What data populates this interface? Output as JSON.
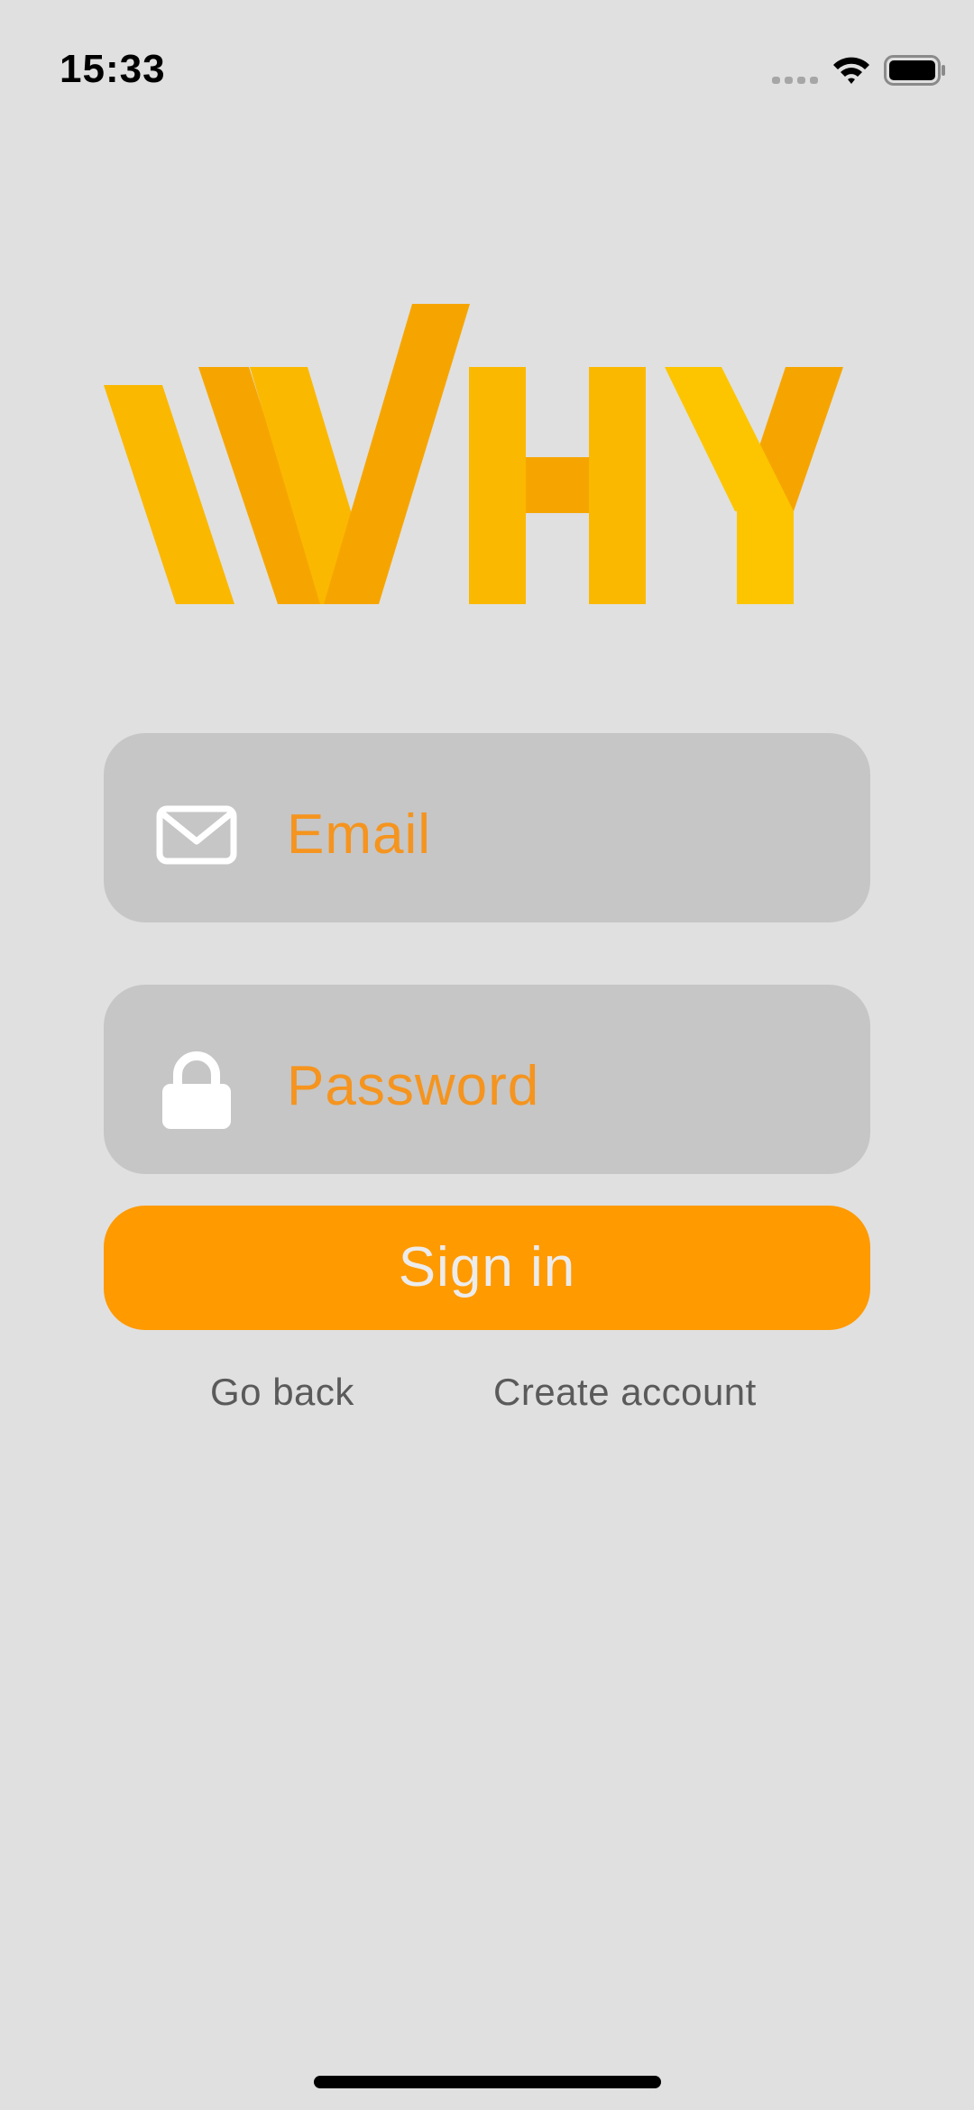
{
  "status_bar": {
    "time": "15:33",
    "signal_icon": "cellular-signal-dots-icon",
    "wifi_icon": "wifi-icon",
    "battery_icon": "battery-full-icon"
  },
  "logo": {
    "text": "WHY",
    "colors": [
      "#fbb800",
      "#f6a500",
      "#fcc500"
    ]
  },
  "login_form": {
    "email": {
      "icon": "envelope-icon",
      "placeholder": "Email"
    },
    "password": {
      "icon": "lock-icon",
      "placeholder": "Password"
    },
    "sign_in_label": "Sign in"
  },
  "links": {
    "go_back": "Go back",
    "create_account": "Create account"
  },
  "colors": {
    "background": "#e0e0e0",
    "field_background": "#c6c6c6",
    "accent": "#ff9a00",
    "placeholder_text": "#f5941e",
    "link_text": "#5a5a5a"
  }
}
